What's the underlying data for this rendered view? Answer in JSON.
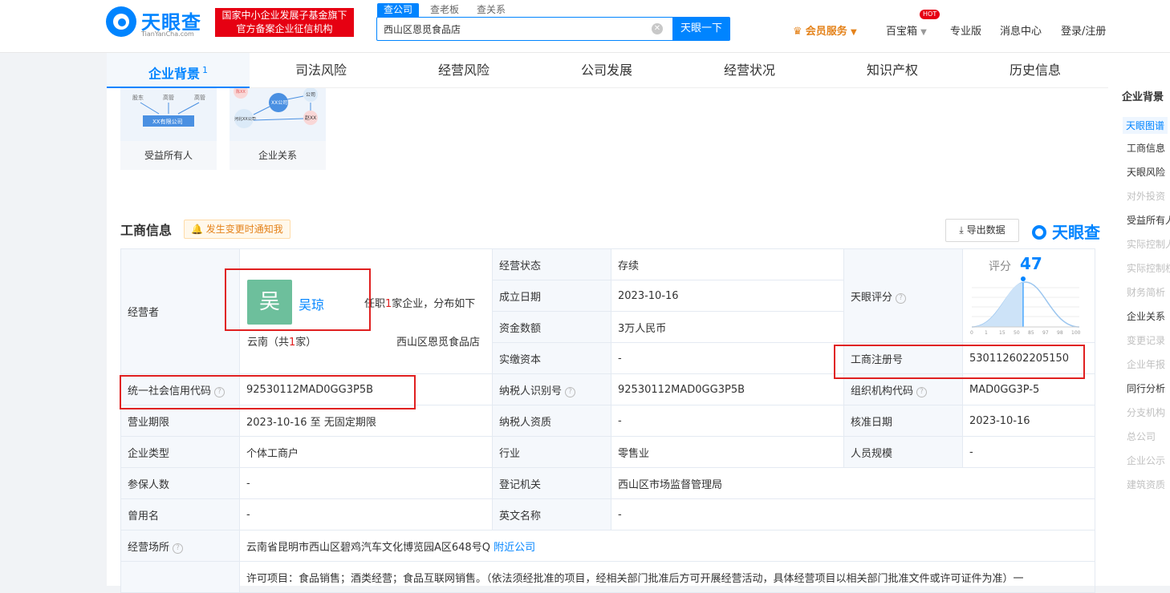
{
  "brand": {
    "name": "天眼查",
    "sub": "TianYanCha.com",
    "slogan_line1": "国家中小企业发展子基金旗下",
    "slogan_line2": "官方备案企业征信机构"
  },
  "search": {
    "tabs": [
      "查公司",
      "查老板",
      "查关系"
    ],
    "query": "西山区恩觅食品店",
    "button": "天眼一下"
  },
  "topnav": {
    "vip": "会员服务",
    "toolbox": "百宝箱",
    "hot": "HOT",
    "pro": "专业版",
    "messages": "消息中心",
    "login": "登录/注册"
  },
  "tabs": [
    {
      "label": "企业背景",
      "count": "1"
    },
    {
      "label": "司法风险"
    },
    {
      "label": "经营风险"
    },
    {
      "label": "公司发展"
    },
    {
      "label": "经营状况"
    },
    {
      "label": "知识产权"
    },
    {
      "label": "历史信息"
    }
  ],
  "cards": [
    {
      "label": "受益所有人",
      "img": [
        "股东",
        "高管",
        "高管",
        "XX有限公司"
      ]
    },
    {
      "label": "企业关系",
      "img": [
        "XX公司",
        "公司",
        "河北XX公司",
        "赵XX",
        "陈XX"
      ]
    }
  ],
  "section": {
    "title": "工商信息",
    "notify": "发生变更时通知我",
    "export": "导出数据",
    "watermark": "天眼查"
  },
  "operator": {
    "label": "经营者",
    "avatar": "吴",
    "name": "吴琼",
    "summary_pre": "任职",
    "summary_count": "1",
    "summary_post": "家企业，分布如下",
    "region_pre": "云南（共",
    "region_count": "1",
    "region_post": "家）",
    "company": "西山区恩觅食品店"
  },
  "fields": {
    "status": {
      "k": "经营状态",
      "v": "存续"
    },
    "founded": {
      "k": "成立日期",
      "v": "2023-10-16"
    },
    "capital": {
      "k": "资金数额",
      "v": "3万人民币"
    },
    "paid": {
      "k": "实缴资本",
      "v": "-"
    },
    "score": {
      "k": "天眼评分",
      "label": "评分",
      "value": "47",
      "ticks": [
        "0",
        "1",
        "15",
        "50",
        "85",
        "97",
        "98",
        "100"
      ]
    },
    "regno": {
      "k": "工商注册号",
      "v": "530112602205150"
    },
    "credit": {
      "k": "统一社会信用代码",
      "v": "92530112MAD0GG3P5B"
    },
    "taxid": {
      "k": "纳税人识别号",
      "v": "92530112MAD0GG3P5B"
    },
    "orgcode": {
      "k": "组织机构代码",
      "v": "MAD0GG3P-5"
    },
    "term": {
      "k": "营业期限",
      "v": "2023-10-16 至 无固定期限"
    },
    "taxqual": {
      "k": "纳税人资质",
      "v": "-"
    },
    "approve": {
      "k": "核准日期",
      "v": "2023-10-16"
    },
    "type": {
      "k": "企业类型",
      "v": "个体工商户"
    },
    "industry": {
      "k": "行业",
      "v": "零售业"
    },
    "staff": {
      "k": "人员规模",
      "v": "-"
    },
    "insured": {
      "k": "参保人数",
      "v": "-"
    },
    "authority": {
      "k": "登记机关",
      "v": "西山区市场监督管理局"
    },
    "formername": {
      "k": "曾用名",
      "v": "-"
    },
    "enname": {
      "k": "英文名称",
      "v": "-"
    },
    "address": {
      "k": "经营场所",
      "v": "云南省昆明市西山区碧鸡汽车文化博览园A区648号Q",
      "link": "附近公司"
    },
    "scope": {
      "v": "许可项目：食品销售；酒类经营；食品互联网销售。（依法须经批准的项目，经相关部门批准后方可开展经营活动，具体经营项目以相关部门批准文件或许可证件为准）一"
    }
  },
  "sidebar": {
    "head": "企业背景",
    "items": [
      {
        "label": "天眼图谱",
        "state": "active"
      },
      {
        "label": "工商信息",
        "state": "normal"
      },
      {
        "label": "天眼风险",
        "state": "normal"
      },
      {
        "label": "对外投资",
        "state": "dim"
      },
      {
        "label": "受益所有人",
        "state": "normal"
      },
      {
        "label": "实际控制人",
        "state": "dim"
      },
      {
        "label": "实际控制权",
        "state": "dim"
      },
      {
        "label": "财务简析",
        "state": "dim"
      },
      {
        "label": "企业关系",
        "state": "normal"
      },
      {
        "label": "变更记录",
        "state": "dim"
      },
      {
        "label": "企业年报",
        "state": "dim"
      },
      {
        "label": "同行分析",
        "state": "normal"
      },
      {
        "label": "分支机构",
        "state": "dim"
      },
      {
        "label": "总公司",
        "state": "dim"
      },
      {
        "label": "企业公示",
        "state": "dim"
      },
      {
        "label": "建筑资质",
        "state": "dim"
      }
    ]
  },
  "colors": {
    "brand": "#0084ff",
    "highlight": "#e02020",
    "vip": "#e4821a"
  }
}
